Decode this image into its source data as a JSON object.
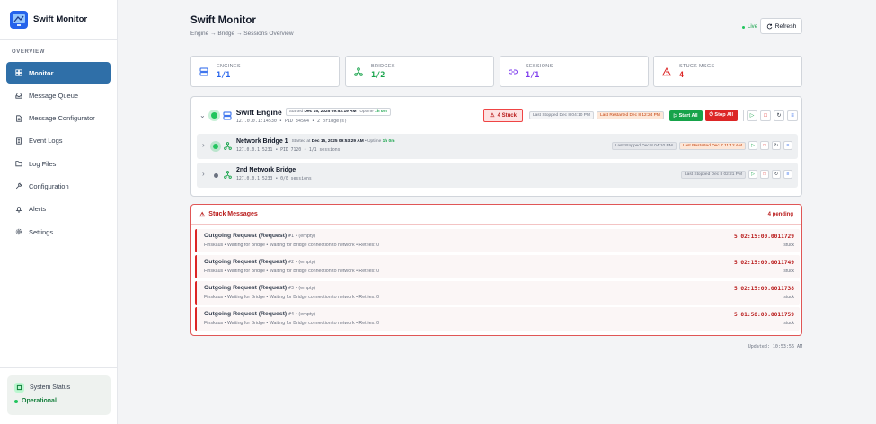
{
  "app": {
    "title": "Swift Monitor"
  },
  "sidebar": {
    "section_label": "OVERVIEW",
    "items": [
      {
        "label": "Monitor",
        "icon": "dashboard-icon",
        "active": true
      },
      {
        "label": "Message Queue",
        "icon": "inbox-icon"
      },
      {
        "label": "Message Configurator",
        "icon": "document-icon"
      },
      {
        "label": "Event Logs",
        "icon": "list-icon"
      },
      {
        "label": "Log Files",
        "icon": "folder-icon"
      },
      {
        "label": "Configuration",
        "icon": "wrench-icon"
      },
      {
        "label": "Alerts",
        "icon": "bell-icon"
      },
      {
        "label": "Settings",
        "icon": "gear-icon"
      }
    ],
    "system_status": {
      "title": "System Status",
      "value": "Operational"
    }
  },
  "header": {
    "title": "Swift Monitor",
    "breadcrumb": "Engine → Bridge → Sessions Overview",
    "live_label": "Live",
    "refresh_label": "Refresh"
  },
  "stats": [
    {
      "label": "ENGINES",
      "value": "1/1",
      "color": "#2563eb",
      "icon": "server-icon"
    },
    {
      "label": "BRIDGES",
      "value": "1/2",
      "color": "#16a34a",
      "icon": "network-icon"
    },
    {
      "label": "SESSIONS",
      "value": "1/1",
      "color": "#7c3aed",
      "icon": "link-icon"
    },
    {
      "label": "STUCK MSGS",
      "value": "4",
      "color": "#dc2626",
      "icon": "warning-icon"
    }
  ],
  "engine": {
    "name": "Swift Engine",
    "started_prefix": "Started",
    "started_at": "Dec 15, 2025 09:53:19 AM",
    "uptime_prefix": "Uptime",
    "uptime": "1h 0m",
    "meta": "127.0.0.1:14530 • PID 34564 • 2 bridge(s)",
    "stuck_badge": "4 Stuck",
    "last_stopped": "Last Stopped Dec 8 04:10 PM",
    "last_restarted": "Last Restarted Dec 8 12:24 PM",
    "start_all": "Start All",
    "stop_all": "Stop All"
  },
  "bridges": [
    {
      "name": "Network Bridge 1",
      "started_prefix": "Started at",
      "started_at": "Dec 15, 2025 09:53:29 AM",
      "uptime_prefix": "Uptime",
      "uptime": "1h 0m",
      "meta": "127.0.0.1:5231 • PID 7120 • 1/1 sessions",
      "last_stopped": "Last Stopped Dec 8 04:10 PM",
      "last_restarted": "Last Restarted Dec 7 11:12 AM",
      "running": true
    },
    {
      "name": "2nd Network Bridge",
      "meta": "127.0.0.1:5233 • 0/0 sessions",
      "last_stopped": "Last Stopped Dec 8 02:21 PM",
      "running": false
    }
  ],
  "stuck": {
    "title": "Stuck Messages",
    "count_label": "4 pending",
    "messages": [
      {
        "title": "Outgoing Request (Request)",
        "num": "#1",
        "status": "• (empty)",
        "sub": "Finskaus • Waiting for Bridge • Waiting for Bridge connection to network • Retries: 0",
        "time": "5.02:15:00.0011729",
        "state": "stuck"
      },
      {
        "title": "Outgoing Request (Request)",
        "num": "#2",
        "status": "• (empty)",
        "sub": "Finskaus • Waiting for Bridge • Waiting for Bridge connection to network • Retries: 0",
        "time": "5.02:15:00.0011749",
        "state": "stuck"
      },
      {
        "title": "Outgoing Request (Request)",
        "num": "#3",
        "status": "• (empty)",
        "sub": "Finskaus • Waiting for Bridge • Waiting for Bridge connection to network • Retries: 0",
        "time": "5.02:15:00.0011738",
        "state": "stuck"
      },
      {
        "title": "Outgoing Request (Request)",
        "num": "#4",
        "status": "• (empty)",
        "sub": "Finskaus • Waiting for Bridge • Waiting for Bridge connection to network • Retries: 0",
        "time": "5.01:58:00.0011759",
        "state": "stuck"
      }
    ]
  },
  "updated": "Updated: 10:53:56 AM"
}
